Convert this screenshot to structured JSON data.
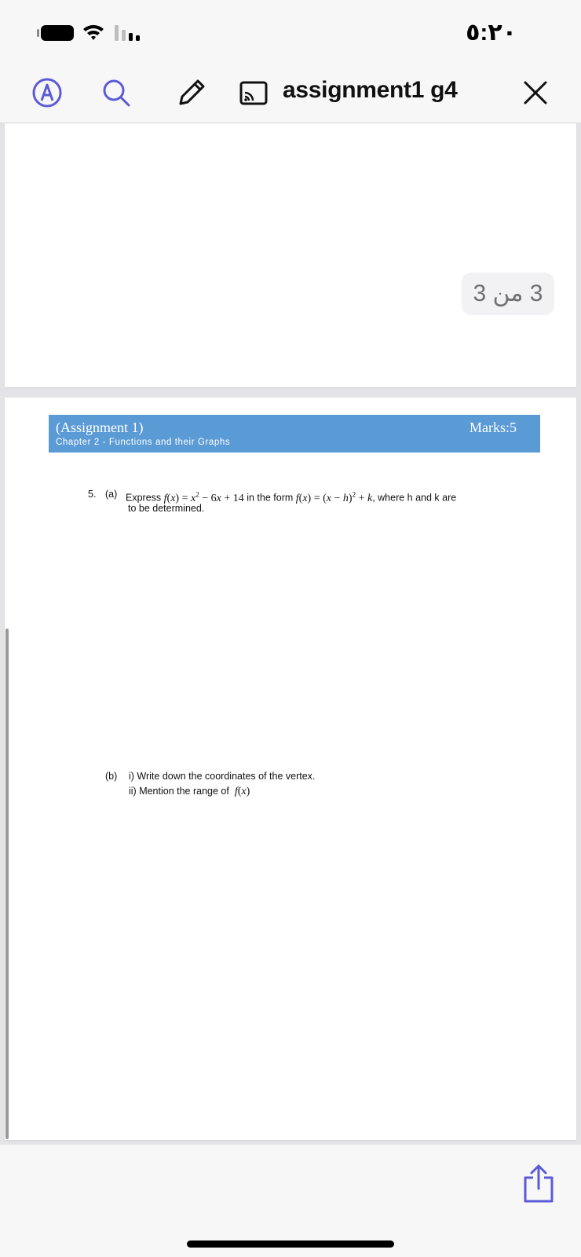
{
  "status_bar": {
    "time": "٥:٢٠"
  },
  "toolbar": {
    "document_title": "assignment1 g4"
  },
  "viewer": {
    "page_counter": "3 من 3"
  },
  "document": {
    "header": {
      "title": "(Assignment 1)",
      "subtitle": "Chapter 2 - Functions and their Graphs",
      "marks": "Marks:5"
    },
    "question": {
      "number": "5.",
      "part_a_label": "(a)",
      "part_a_text_1": "Express",
      "part_a_text_2": "in the form",
      "part_a_text_3": ", where h and k are",
      "part_a_text_cont": "to be determined.",
      "part_b_label": "(b)",
      "part_b_item_1": "i)  Write down the coordinates of the vertex.",
      "part_b_item_2": "ii)  Mention the range of"
    }
  },
  "colors": {
    "header_band": "#5b9bd5",
    "accent_icon": "#5b5bd6"
  },
  "icons": {
    "markup": "markup-icon",
    "search": "search-icon",
    "edit": "pencil-icon",
    "cast": "cast-icon",
    "close": "close-icon",
    "share": "share-icon"
  }
}
